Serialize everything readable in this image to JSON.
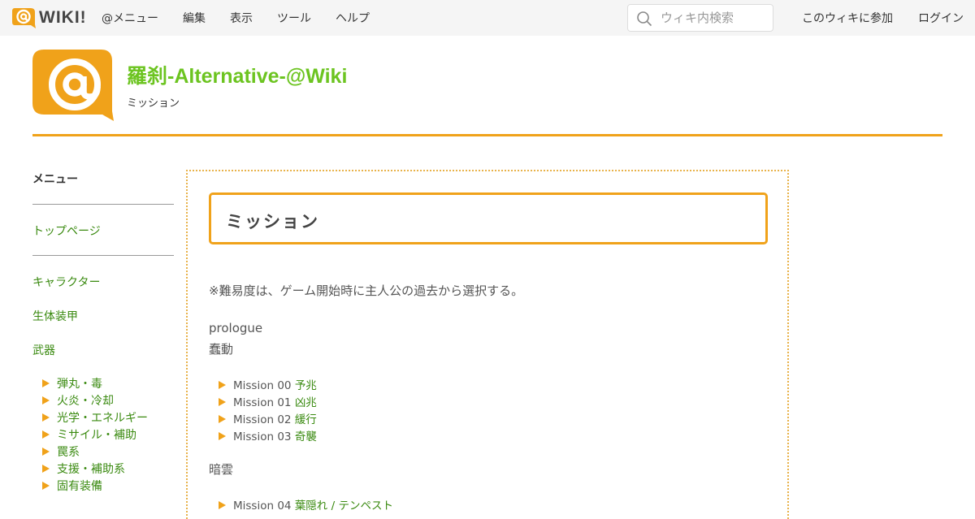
{
  "topbar": {
    "logo_text": "WIKI!",
    "menu": [
      "@メニュー",
      "編集",
      "表示",
      "ツール",
      "ヘルプ"
    ],
    "search_placeholder": "ウィキ内検索",
    "join": "このウィキに参加",
    "login": "ログイン"
  },
  "header": {
    "title": "羅刹-Alternative-@Wiki",
    "subtitle": "ミッション"
  },
  "sidebar": {
    "title": "メニュー",
    "top_page": "トップページ",
    "links": [
      "キャラクター",
      "生体装甲",
      "武器"
    ],
    "weapon_sub": [
      "弾丸・毒",
      "火炎・冷却",
      "光学・エネルギー",
      "ミサイル・補助",
      "罠系",
      "支援・補助系",
      "固有装備"
    ]
  },
  "main": {
    "heading": "ミッション",
    "note": "※難易度は、ゲーム開始時に主人公の過去から選択する。",
    "prologue_label": "prologue",
    "section1": "蠢動",
    "section1_missions": [
      {
        "num": "Mission 00",
        "name": "予兆"
      },
      {
        "num": "Mission 01",
        "name": "凶兆"
      },
      {
        "num": "Mission 02",
        "name": "緩行"
      },
      {
        "num": "Mission 03",
        "name": "奇襲"
      }
    ],
    "section2": "暗雲",
    "section2_missions": [
      {
        "num": "Mission 04",
        "name": "葉隠れ / テンペスト"
      }
    ]
  },
  "colors": {
    "accent": "#f0a21a",
    "link": "#3a8a10",
    "title_green": "#6cc420"
  }
}
